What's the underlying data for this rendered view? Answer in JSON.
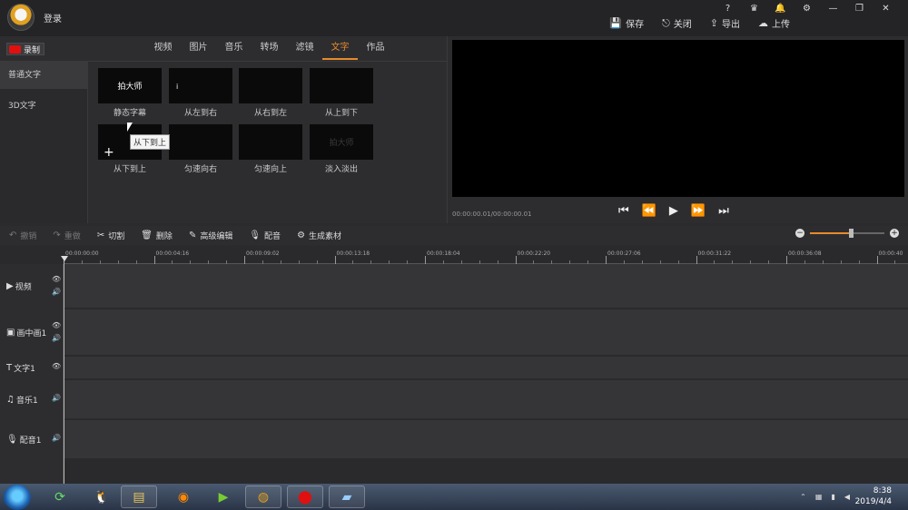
{
  "header": {
    "login_label": "登录",
    "win_buttons": [
      "?",
      "♛",
      "🔔",
      "⚙",
      "—",
      "❐",
      "✕"
    ],
    "actions": [
      {
        "icon": "save-icon",
        "glyph": "💾",
        "label": "保存"
      },
      {
        "icon": "close-icon",
        "glyph": "⎋",
        "label": "关闭"
      },
      {
        "icon": "export-icon",
        "glyph": "⇪",
        "label": "导出"
      },
      {
        "icon": "upload-icon",
        "glyph": "☁",
        "label": "上传"
      }
    ]
  },
  "library": {
    "record_label": "录制",
    "tabs": [
      "视频",
      "图片",
      "音乐",
      "转场",
      "滤镜",
      "文字",
      "作品"
    ],
    "active_tab": 5,
    "categories": [
      "普通文字",
      "3D文字"
    ],
    "tiles": [
      {
        "label": "静态字幕",
        "thumb_text": "拍大师"
      },
      {
        "label": "从左到右",
        "thumb_text": "i"
      },
      {
        "label": "从右到左",
        "thumb_text": ""
      },
      {
        "label": "从上到下",
        "thumb_text": ""
      },
      {
        "label": "从下到上",
        "thumb_text": ""
      },
      {
        "label": "匀速向右",
        "thumb_text": ""
      },
      {
        "label": "匀速向上",
        "thumb_text": ""
      },
      {
        "label": "淡入淡出",
        "thumb_text": "拍大师"
      }
    ],
    "tooltip": "从下到上"
  },
  "preview": {
    "timecode": "00:00:00.01/00:00:00.01",
    "controls": [
      "⏮",
      "⏪",
      "▶",
      "⏩",
      "⏭"
    ]
  },
  "toolbar": {
    "items": [
      {
        "glyph": "↶",
        "label": "撤销",
        "enabled": false
      },
      {
        "glyph": "↷",
        "label": "重做",
        "enabled": false
      },
      {
        "glyph": "✂",
        "label": "切割",
        "enabled": true
      },
      {
        "glyph": "🗑",
        "label": "删除",
        "enabled": true
      },
      {
        "glyph": "✎",
        "label": "高级编辑",
        "enabled": true
      },
      {
        "glyph": "🎙",
        "label": "配音",
        "enabled": true
      },
      {
        "glyph": "⚙",
        "label": "生成素材",
        "enabled": true
      }
    ],
    "zoom_minus": "−",
    "zoom_plus": "+",
    "zoom_level": 0.55
  },
  "timeline": {
    "ruler_ticks": [
      "00:00:00:00",
      "00:00:04:16",
      "00:00:09:02",
      "00:00:13:18",
      "00:00:18:04",
      "00:00:22:20",
      "00:00:27:06",
      "00:00:31:22",
      "00:00:36:08",
      "00:00:40"
    ],
    "tracks": [
      {
        "glyph": "▶",
        "name": "视频",
        "icons": [
          "👁",
          "🔊"
        ]
      },
      {
        "glyph": "▣",
        "name": "画中画1",
        "icons": [
          "👁",
          "🔊"
        ]
      },
      {
        "glyph": "T",
        "name": "文字1",
        "icons": [
          "👁"
        ]
      },
      {
        "glyph": "♫",
        "name": "音乐1",
        "icons": [
          "🔊"
        ]
      },
      {
        "glyph": "🎙",
        "name": "配音1",
        "icons": [
          "🔊"
        ]
      }
    ]
  },
  "taskbar": {
    "clock_time": "8:38",
    "clock_date": "2019/4/4"
  }
}
